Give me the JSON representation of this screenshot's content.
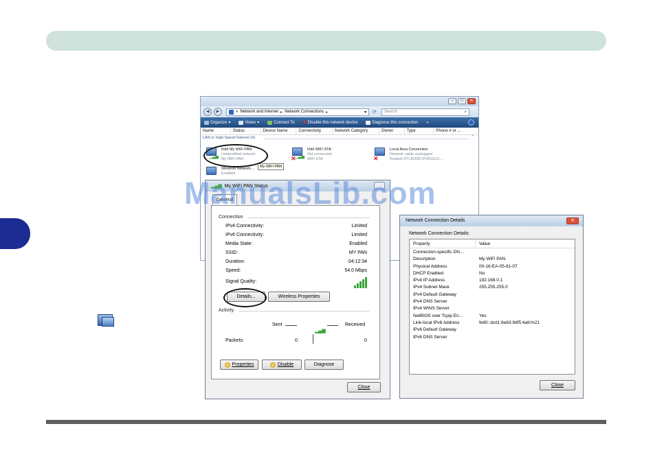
{
  "explorer": {
    "breadcrumb": [
      "Network and Internet",
      "Network Connections"
    ],
    "breadcrumb_prefix": "«",
    "search_placeholder": "Search",
    "toolbar": [
      "Organize",
      "Views",
      "Connect To",
      "Disable this network device",
      "Diagnose this connection",
      "»"
    ],
    "columns": [
      "Name",
      "Status",
      "Device Name",
      "Connectivity",
      "Network Category",
      "Owner",
      "Type",
      "Phone # or ..."
    ],
    "group_label": "LAN or High-Speed Internet (4)",
    "connections": [
      {
        "name": "Intel My WiFi PAN",
        "status": "Unidentified network",
        "device": "My WiFi PAN"
      },
      {
        "name": "Intel WiFi STA",
        "status": "Not connected",
        "device": "WiFi STA"
      },
      {
        "name": "Local Area Connection",
        "status": "Network cable unplugged",
        "device": "Realtek RTL8168C(P)/8111C(..."
      },
      {
        "name": "Wireless Network...",
        "status": "Enabled",
        "device": ""
      }
    ],
    "tooltip": "My WiFi PAN"
  },
  "status_dialog": {
    "title": "My WiFi PAN Status",
    "tab": "General",
    "connection_heading": "Connection",
    "rows": [
      {
        "label": "IPv4 Connectivity:",
        "value": "Limited"
      },
      {
        "label": "IPv6 Connectivity:",
        "value": "Limited"
      },
      {
        "label": "Media State:",
        "value": "Enabled"
      },
      {
        "label": "SSID:",
        "value": "MY PAN"
      },
      {
        "label": "Duration:",
        "value": "04:12:34"
      },
      {
        "label": "Speed:",
        "value": "54.0 Mbps"
      }
    ],
    "signal_label": "Signal Quality:",
    "details_button": "Details...",
    "wireless_button": "Wireless Properties",
    "activity_heading": "Activity",
    "sent_label": "Sent",
    "received_label": "Received",
    "packets_label": "Packets:",
    "packets_sent": "0",
    "packets_received": "0",
    "properties_button": "Properties",
    "disable_button": "Disable",
    "diagnose_button": "Diagnose",
    "close_button": "Close"
  },
  "details_dialog": {
    "title": "Network Connection Details",
    "caption": "Network Connection Details:",
    "col_property": "Property",
    "col_value": "Value",
    "rows": [
      {
        "p": "Connection-specific DN...",
        "v": ""
      },
      {
        "p": "Description",
        "v": "My WiFi PAN"
      },
      {
        "p": "Physical Address",
        "v": "00-16-EA-05-61-07"
      },
      {
        "p": "DHCP Enabled",
        "v": "No"
      },
      {
        "p": "IPv4 IP Address",
        "v": "192.168.0.1"
      },
      {
        "p": "IPv4 Subnet Mask",
        "v": "255.255.255.0"
      },
      {
        "p": "IPv4 Default Gateway",
        "v": ""
      },
      {
        "p": "IPv4 DNS Server",
        "v": ""
      },
      {
        "p": "IPv4 WINS Server",
        "v": ""
      },
      {
        "p": "NetBIOS over Tcpip En...",
        "v": "Yes"
      },
      {
        "p": "Link-local IPv6 Address",
        "v": "fe80::dcd1:6e63:9df5:4afc%21"
      },
      {
        "p": "IPv6 Default Gateway",
        "v": ""
      },
      {
        "p": "IPv6 DNS Server",
        "v": ""
      }
    ],
    "close_button": "Close"
  },
  "watermark": "ManualsLib.com",
  "colors": {
    "header_band": "#cfe3dc",
    "side_tab": "#1c2c92",
    "toolbar": "#2b5a92",
    "signal_green": "#3aa53a"
  }
}
